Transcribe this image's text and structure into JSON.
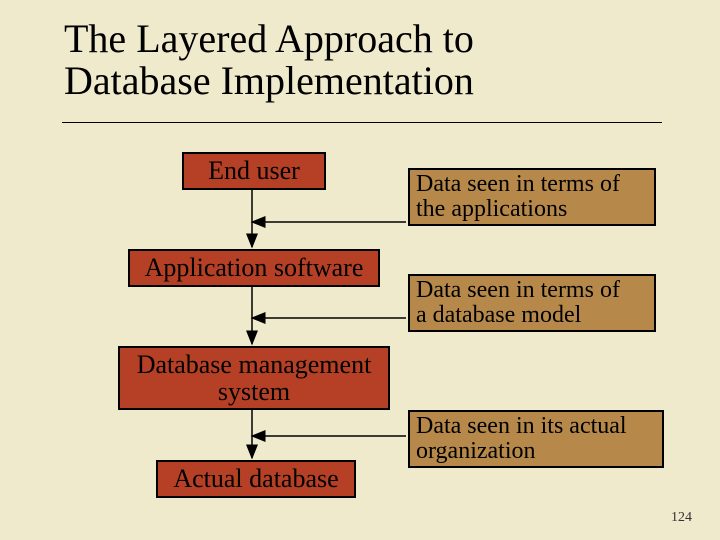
{
  "title_line1": "The Layered Approach to",
  "title_line2": "Database Implementation",
  "layers": {
    "end_user": "End user",
    "app_sw": "Application software",
    "dbms_l1": "Database management",
    "dbms_l2": "system",
    "actual_db": "Actual database"
  },
  "descs": {
    "d1_l1": "Data seen in terms of",
    "d1_l2": "the applications",
    "d2_l1": "Data seen in terms of",
    "d2_l2": "a database model",
    "d3_l1": "Data seen in its actual",
    "d3_l2": "organization"
  },
  "page_number": "124"
}
